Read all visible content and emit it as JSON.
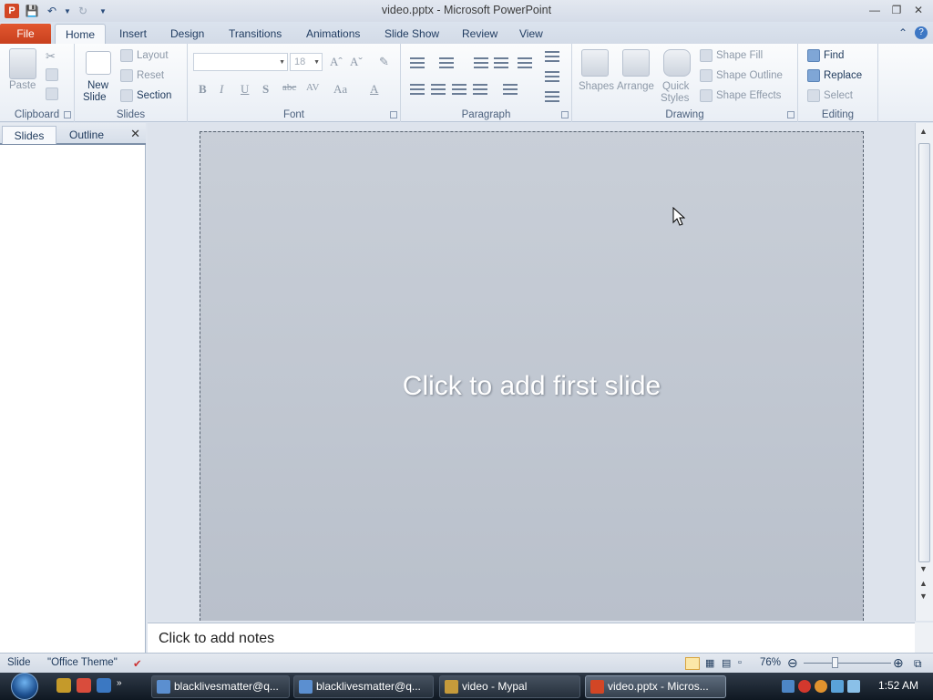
{
  "window": {
    "title": "video.pptx - Microsoft PowerPoint",
    "app_icon_letter": "P"
  },
  "tabs": [
    "File",
    "Home",
    "Insert",
    "Design",
    "Transitions",
    "Animations",
    "Slide Show",
    "Review",
    "View"
  ],
  "ribbon": {
    "clipboard": {
      "label": "Clipboard",
      "paste": "Paste"
    },
    "slides": {
      "label": "Slides",
      "new_slide_1": "New",
      "new_slide_2": "Slide",
      "layout": "Layout",
      "reset": "Reset",
      "section": "Section"
    },
    "font": {
      "label": "Font",
      "size": "18"
    },
    "paragraph": {
      "label": "Paragraph"
    },
    "drawing": {
      "label": "Drawing",
      "shapes": "Shapes",
      "arrange": "Arrange",
      "quick_styles_1": "Quick",
      "quick_styles_2": "Styles",
      "shape_fill": "Shape Fill",
      "shape_outline": "Shape Outline",
      "shape_effects": "Shape Effects"
    },
    "editing": {
      "label": "Editing",
      "find": "Find",
      "replace": "Replace",
      "select": "Select"
    }
  },
  "left_panel": {
    "tab_slides": "Slides",
    "tab_outline": "Outline"
  },
  "slide": {
    "placeholder": "Click to add first slide"
  },
  "notes": {
    "placeholder": "Click to add notes"
  },
  "status": {
    "slide": "Slide",
    "theme": "\"Office Theme\"",
    "zoom": "76%"
  },
  "taskbar": {
    "items": [
      "blacklivesmatter@q...",
      "blacklivesmatter@q...",
      "video - Mypal",
      "video.pptx - Micros..."
    ],
    "clock": "1:52 AM"
  },
  "colors": {
    "file_tab": "#d24625",
    "slide_bg": "#c2c8d1",
    "taskbar": "#1c2632"
  }
}
